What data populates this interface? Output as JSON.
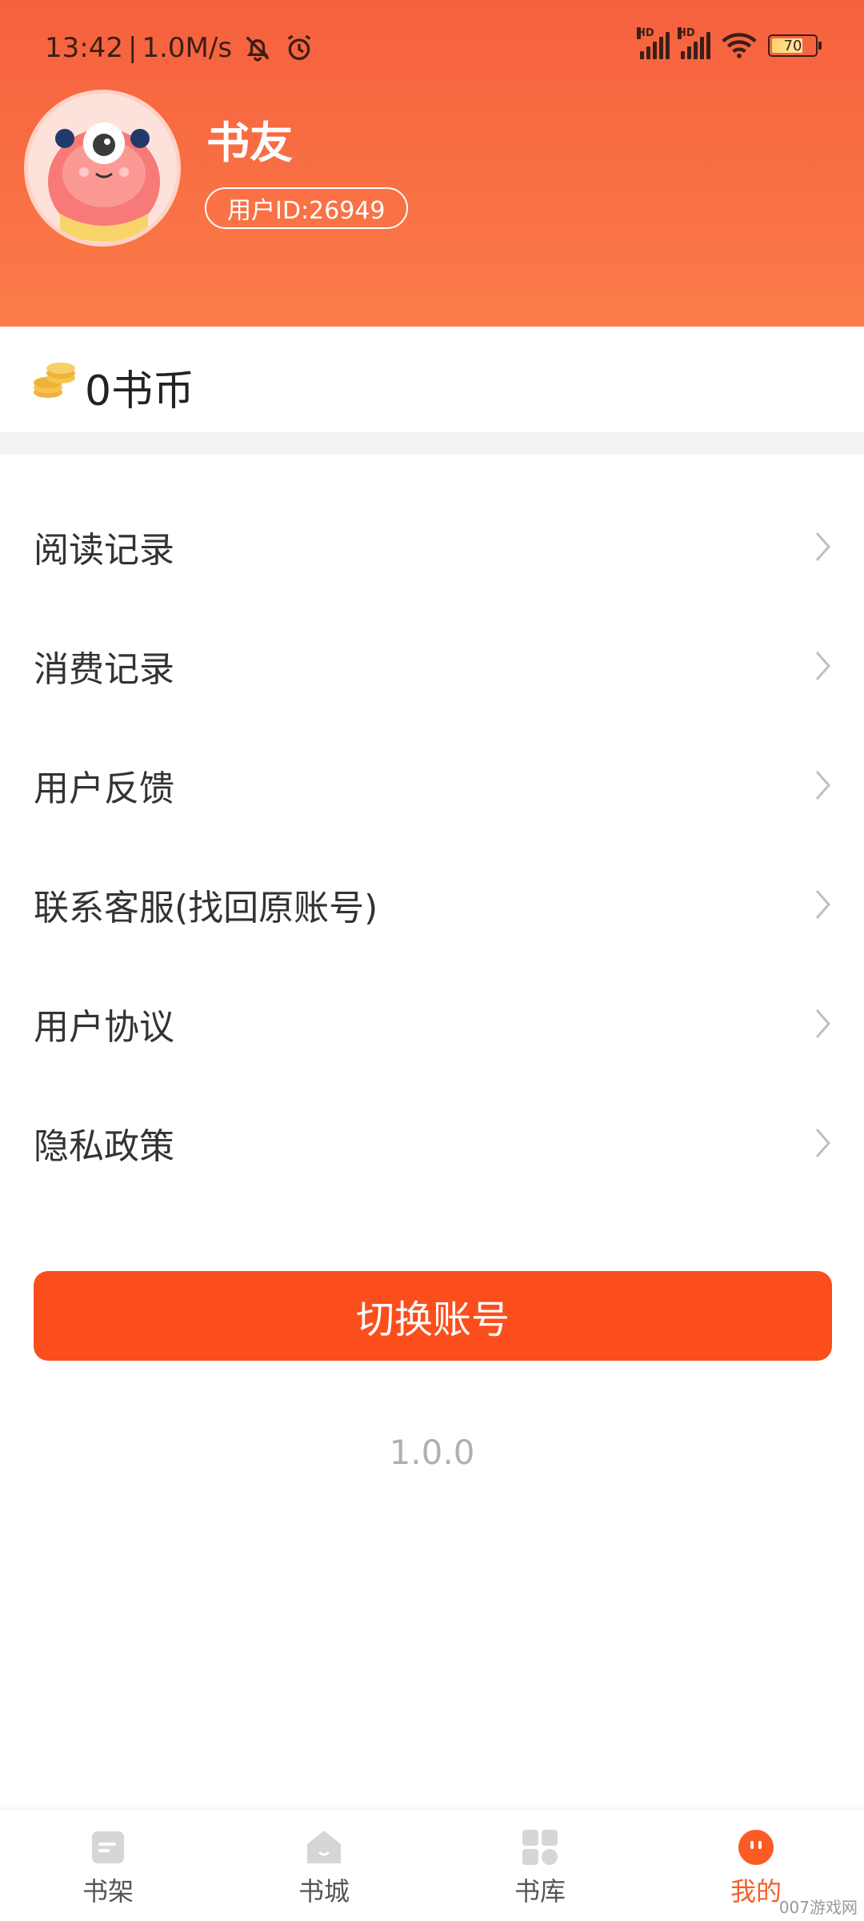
{
  "status_bar": {
    "time": "13:42",
    "net_speed": "1.0M/s",
    "hd1": "HD",
    "hd2": "HD",
    "battery": "70"
  },
  "profile": {
    "name": "书友",
    "user_id": "用户ID:26949"
  },
  "coins": {
    "text": "0书币"
  },
  "menu": {
    "items": [
      {
        "label": "阅读记录"
      },
      {
        "label": "消费记录"
      },
      {
        "label": "用户反馈"
      },
      {
        "label": "联系客服(找回原账号)"
      },
      {
        "label": "用户协议"
      },
      {
        "label": "隐私政策"
      }
    ]
  },
  "actions": {
    "switch_account": "切换账号"
  },
  "version": "1.0.0",
  "tabs": [
    {
      "label": "书架",
      "icon": "bookshelf-icon"
    },
    {
      "label": "书城",
      "icon": "bookstore-icon"
    },
    {
      "label": "书库",
      "icon": "library-icon"
    },
    {
      "label": "我的",
      "icon": "profile-icon",
      "active": true
    }
  ],
  "watermark": "007游戏网",
  "colors": {
    "accent": "#fc4e1c",
    "header_top": "#f6603e",
    "header_bottom": "#fb7c49",
    "tab_active": "#fb5c26"
  }
}
